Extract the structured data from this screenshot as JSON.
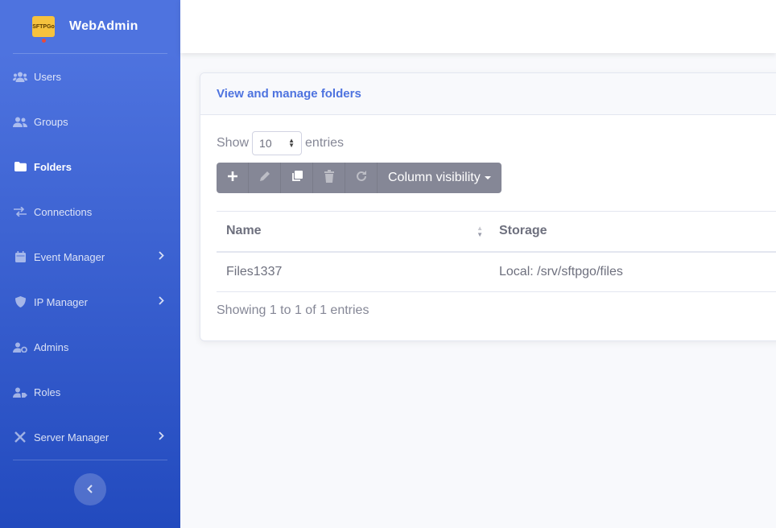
{
  "brand": {
    "logo_text": "SFTPGo",
    "title": "WebAdmin"
  },
  "sidebar": {
    "items": [
      {
        "label": "Users",
        "icon": "users-icon",
        "active": false,
        "has_submenu": false
      },
      {
        "label": "Groups",
        "icon": "user-friends-icon",
        "active": false,
        "has_submenu": false
      },
      {
        "label": "Folders",
        "icon": "folder-icon",
        "active": true,
        "has_submenu": false
      },
      {
        "label": "Connections",
        "icon": "exchange-icon",
        "active": false,
        "has_submenu": false
      },
      {
        "label": "Event Manager",
        "icon": "calendar-icon",
        "active": false,
        "has_submenu": true
      },
      {
        "label": "IP Manager",
        "icon": "shield-icon",
        "active": false,
        "has_submenu": true
      },
      {
        "label": "Admins",
        "icon": "user-cog-icon",
        "active": false,
        "has_submenu": false
      },
      {
        "label": "Roles",
        "icon": "user-tag-icon",
        "active": false,
        "has_submenu": false
      },
      {
        "label": "Server Manager",
        "icon": "tools-icon",
        "active": false,
        "has_submenu": true
      }
    ],
    "toggle_icon": "chevron-left-icon"
  },
  "card": {
    "title": "View and manage folders",
    "length": {
      "prefix": "Show",
      "value": "10",
      "suffix": "entries"
    },
    "toolbar": {
      "buttons": [
        "plus-icon",
        "pencil-icon",
        "clone-icon",
        "trash-icon",
        "refresh-icon"
      ],
      "column_visibility_label": "Column visibility"
    },
    "table": {
      "columns": [
        "Name",
        "Storage"
      ],
      "rows": [
        {
          "name": "Files1337",
          "storage": "Local: /srv/sftpgo/files"
        }
      ]
    },
    "info": "Showing 1 to 1 of 1 entries"
  },
  "colors": {
    "primary": "#4e73df",
    "secondary": "#858796"
  }
}
